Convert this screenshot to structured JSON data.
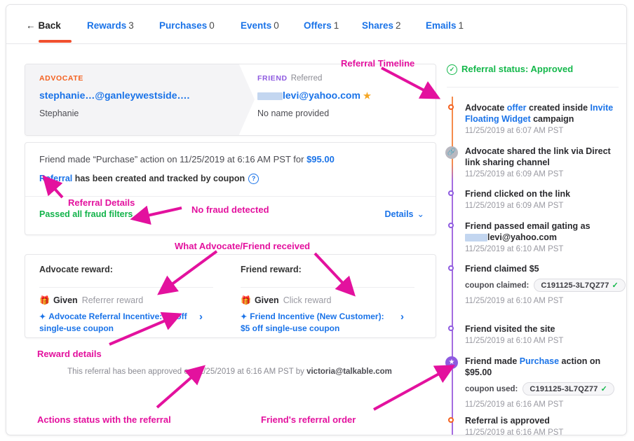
{
  "tabs": [
    {
      "label": "Back",
      "count": "",
      "icon": "back-arrow-icon"
    },
    {
      "label": "Rewards",
      "count": "3"
    },
    {
      "label": "Purchases",
      "count": "0"
    },
    {
      "label": "Events",
      "count": "0"
    },
    {
      "label": "Offers",
      "count": "1"
    },
    {
      "label": "Shares",
      "count": "2"
    },
    {
      "label": "Emails",
      "count": "1"
    }
  ],
  "parties": {
    "advocate": {
      "label": "ADVOCATE",
      "email": "stephanie…@ganleywestside….",
      "name": "Stephanie"
    },
    "friend": {
      "label": "FRIEND",
      "status": "Referred",
      "email": "levi@yahoo.com",
      "name": "No name provided",
      "star_icon": "star-icon"
    }
  },
  "purchase": {
    "summary_prefix": "Friend made “Purchase” action on 11/25/2019 at 6:16 AM PST for ",
    "amount": "$95.00",
    "referral_link": "Referral",
    "referral_rest": " has been created and tracked by coupon",
    "help_icon": "question-mark-icon",
    "fraud_status": "Passed all fraud filters",
    "details_label": "Details",
    "details_chevron": "chevron-down-icon"
  },
  "rewards": {
    "advocate": {
      "heading": "Advocate reward:",
      "state": "Given",
      "type": "Referrer reward",
      "incentive": "Advocate Referral Incentive: $5 off single-use coupon"
    },
    "friend": {
      "heading": "Friend reward:",
      "state": "Given",
      "type": "Click reward",
      "incentive": "Friend Incentive (New Customer): $5 off single-use coupon"
    }
  },
  "approval_note": {
    "text": "This referral has been approved on 11/25/2019 at 6:16 AM PST by ",
    "approver": "victoria@talkable.com"
  },
  "timeline": {
    "status_label": "Referral status: Approved",
    "status_icon": "check-circle-icon",
    "events": [
      {
        "marker": "ring-orange",
        "title_pre": "Advocate ",
        "title_link1": "offer",
        "title_mid": " created inside ",
        "title_link2": "Invite Floating Widget",
        "title_post": " campaign",
        "time": "11/25/2019 at 6:07 AM PST"
      },
      {
        "marker": "link-icon",
        "title_pre": "Advocate shared the link via Direct link sharing channel",
        "time": "11/25/2019 at 6:09 AM PST"
      },
      {
        "marker": "ring-purple",
        "title_pre": "Friend clicked on the link",
        "time": "11/25/2019 at 6:09 AM PST"
      },
      {
        "marker": "ring-purple",
        "title_pre": "Friend passed email gating as",
        "title_email": "levi@yahoo.com",
        "time": "11/25/2019 at 6:10 AM PST"
      },
      {
        "marker": "ring-purple",
        "title_pre": "Friend claimed $5",
        "coupon_label": "coupon claimed:",
        "coupon_code": "C191125-3L7QZ77",
        "coupon_check": "check-icon",
        "time": "11/25/2019 at 6:10 AM PST"
      },
      {
        "marker": "ring-purple",
        "title_pre": "Friend visited the site",
        "time": "11/25/2019 at 6:10 AM PST"
      },
      {
        "marker": "star-purple",
        "title_pre": "Friend made ",
        "title_link1": "Purchase",
        "title_post": " action on $95.00",
        "coupon_label": "coupon used:",
        "coupon_code": "C191125-3L7QZ77",
        "coupon_check": "check-icon",
        "time": "11/25/2019 at 6:16 AM PST"
      },
      {
        "marker": "ring-orange",
        "title_pre": "Referral is approved",
        "time": "11/25/2019 at 6:16 AM PST"
      }
    ]
  },
  "annotations": [
    {
      "id": "referral-timeline",
      "text": "Referral Timeline"
    },
    {
      "id": "referral-details",
      "text": "Referral Details"
    },
    {
      "id": "no-fraud-detected",
      "text": "No fraud detected"
    },
    {
      "id": "what-received",
      "text": "What Advocate/Friend received"
    },
    {
      "id": "reward-details",
      "text": "Reward details"
    },
    {
      "id": "actions-status",
      "text": "Actions status with the referral"
    },
    {
      "id": "friends-referral-order",
      "text": "Friend's referral order"
    }
  ],
  "colors": {
    "accent_blue": "#1a73e8",
    "advocate_orange": "#f4601e",
    "friend_purple": "#8e5ae0",
    "success_green": "#14b84b",
    "annotation_magenta": "#e3119e"
  }
}
